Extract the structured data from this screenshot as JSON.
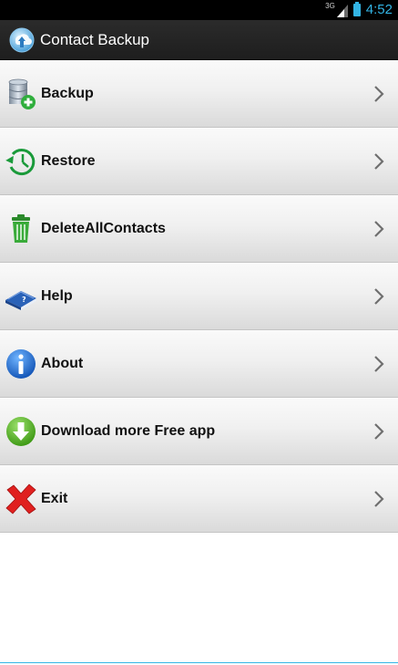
{
  "status_bar": {
    "network_label": "3G",
    "time": "4:52"
  },
  "action_bar": {
    "title": "Contact Backup",
    "icon": "app-backup-icon"
  },
  "menu": {
    "items": [
      {
        "label": "Backup",
        "icon": "database-add-icon"
      },
      {
        "label": "Restore",
        "icon": "history-clock-icon"
      },
      {
        "label": "DeleteAllContacts",
        "icon": "trash-icon"
      },
      {
        "label": "Help",
        "icon": "help-book-icon"
      },
      {
        "label": "About",
        "icon": "info-icon"
      },
      {
        "label": "Download more Free app",
        "icon": "download-arrow-icon"
      },
      {
        "label": "Exit",
        "icon": "red-x-icon"
      }
    ]
  },
  "colors": {
    "status_accent": "#33b5e5",
    "action_bar": "#222222",
    "restore_green": "#1a9a3a",
    "about_blue": "#1e6fd1",
    "exit_red": "#e0201f"
  }
}
